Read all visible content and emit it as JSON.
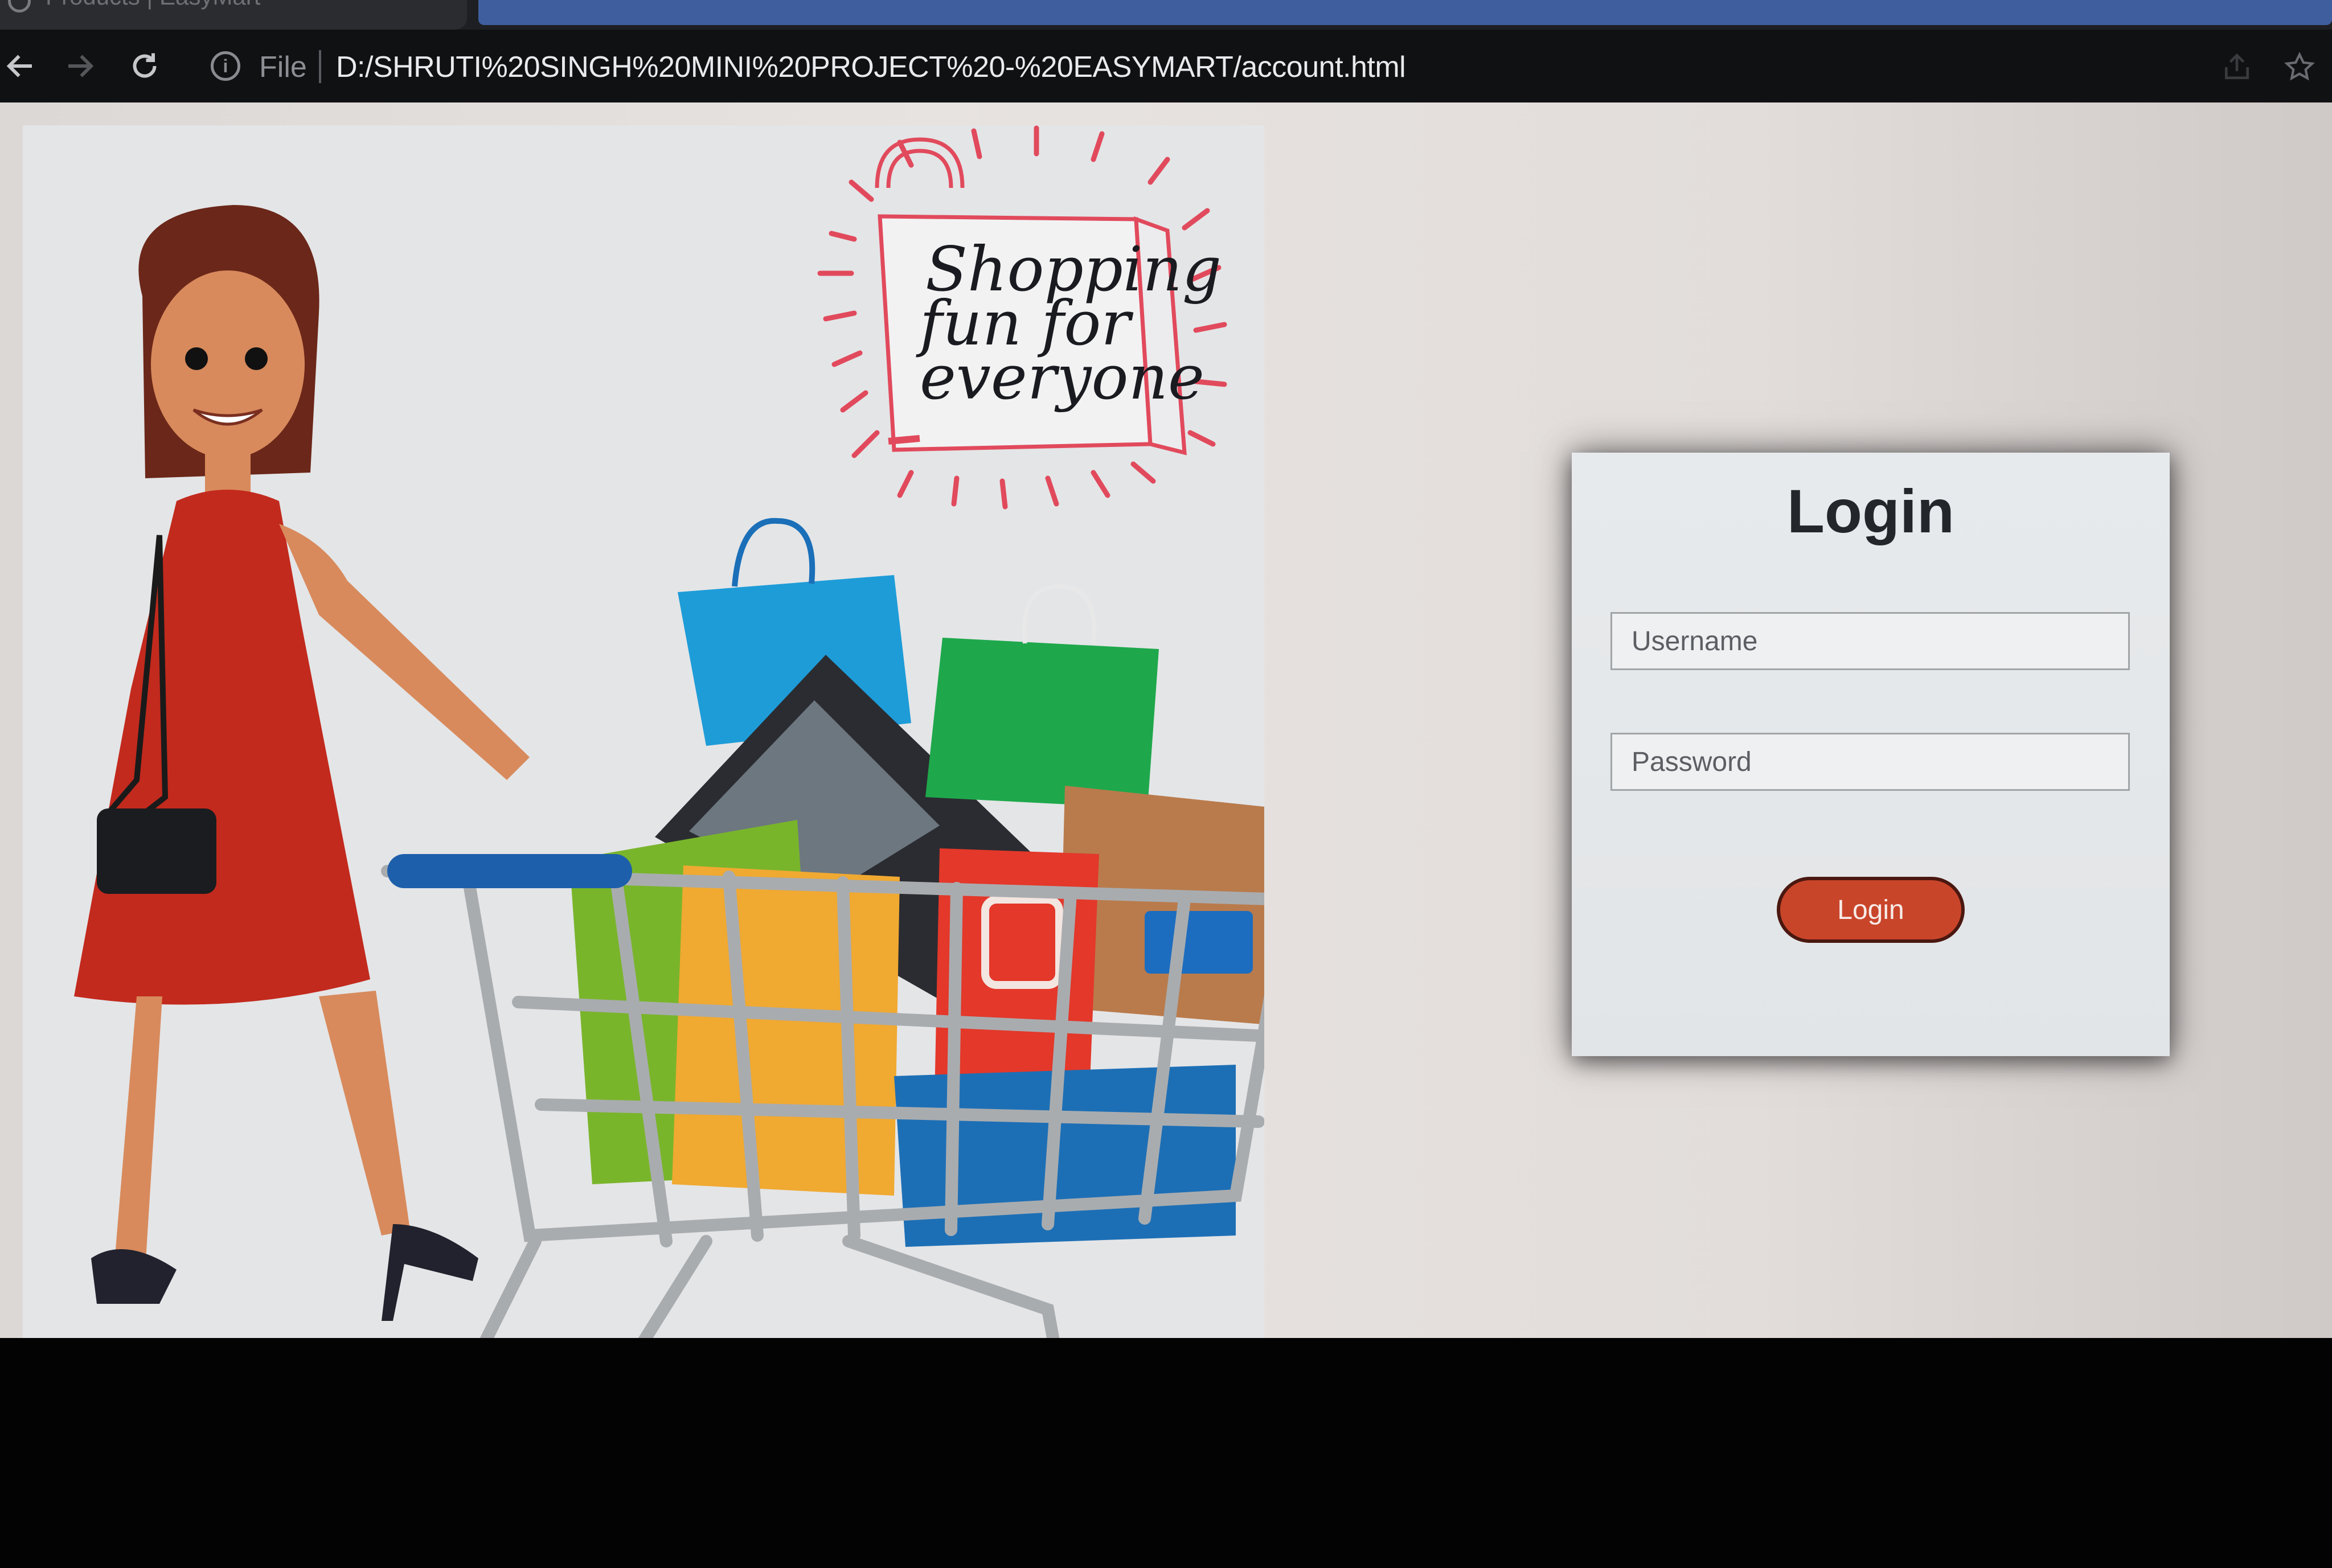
{
  "browser": {
    "tab_title": "Products | EasyMart",
    "file_label": "File",
    "url": "D:/SHRUTI%20SINGH%20MINI%20PROJECT%20-%20EASYMART/account.html",
    "icons": [
      "back-arrow-icon",
      "forward-arrow-icon",
      "reload-icon",
      "info-icon",
      "share-icon",
      "bookmark-star-icon"
    ]
  },
  "hero": {
    "bag_text": [
      "Shopping",
      "fun for",
      "everyone"
    ]
  },
  "login": {
    "title": "Login",
    "username_placeholder": "Username",
    "password_placeholder": "Password",
    "button_label": "Login",
    "button_color": "#c9452a"
  }
}
